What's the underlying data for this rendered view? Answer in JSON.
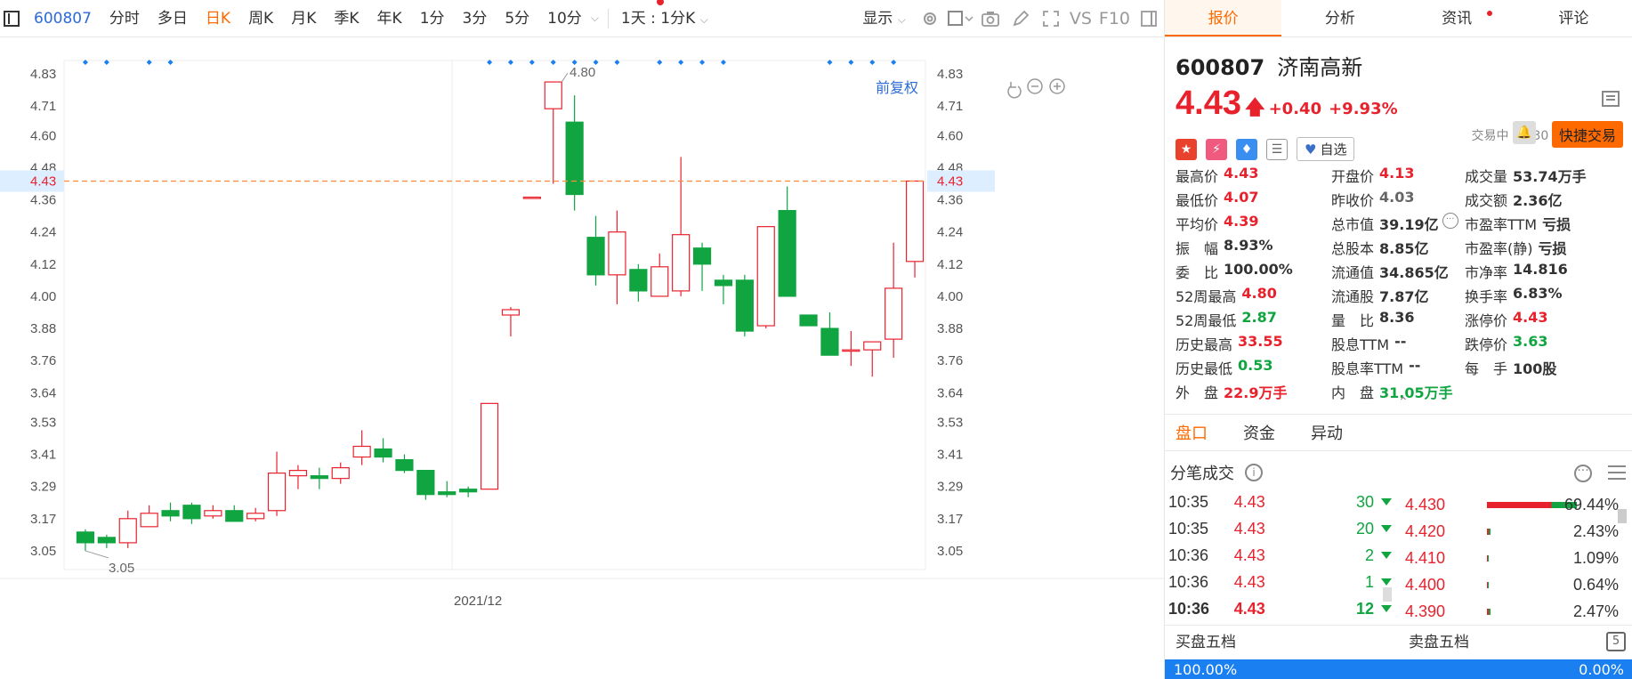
{
  "toolbar": {
    "code": "600807",
    "periods": [
      "分时",
      "多日",
      "日K",
      "周K",
      "月K",
      "季K",
      "年K",
      "1分",
      "3分",
      "5分",
      "10分"
    ],
    "active_period": "日K",
    "interval_select": "1天 : 1分K",
    "display_label": "显示",
    "vs_label": "VS",
    "f10_label": "F10"
  },
  "chart": {
    "adjust_label": "前复权",
    "x_label": "2021/12",
    "current_price_label": "4.43",
    "y_ticks": [
      "4.83",
      "4.71",
      "4.60",
      "4.48",
      "4.36",
      "4.24",
      "4.12",
      "4.00",
      "3.88",
      "3.76",
      "3.64",
      "3.53",
      "3.41",
      "3.29",
      "3.17",
      "3.05"
    ],
    "high_annotation": "4.80",
    "low_annotation": "3.05",
    "colors": {
      "up": "#e8222d",
      "down": "#10a540",
      "current_line": "#ff8a3d",
      "marker": "#1a7ff0"
    }
  },
  "chart_data": {
    "type": "candlestick",
    "ylim": [
      2.98,
      4.88
    ],
    "current_price": 4.43,
    "candles": [
      {
        "o": 3.12,
        "c": 3.08,
        "h": 3.13,
        "l": 3.05
      },
      {
        "o": 3.1,
        "c": 3.08,
        "h": 3.11,
        "l": 3.06
      },
      {
        "o": 3.08,
        "c": 3.17,
        "h": 3.2,
        "l": 3.06
      },
      {
        "o": 3.14,
        "c": 3.19,
        "h": 3.22,
        "l": 3.14
      },
      {
        "o": 3.2,
        "c": 3.18,
        "h": 3.23,
        "l": 3.16
      },
      {
        "o": 3.22,
        "c": 3.17,
        "h": 3.23,
        "l": 3.15
      },
      {
        "o": 3.18,
        "c": 3.2,
        "h": 3.22,
        "l": 3.17
      },
      {
        "o": 3.2,
        "c": 3.16,
        "h": 3.22,
        "l": 3.16
      },
      {
        "o": 3.17,
        "c": 3.19,
        "h": 3.21,
        "l": 3.16
      },
      {
        "o": 3.2,
        "c": 3.34,
        "h": 3.42,
        "l": 3.18
      },
      {
        "o": 3.33,
        "c": 3.35,
        "h": 3.37,
        "l": 3.28
      },
      {
        "o": 3.33,
        "c": 3.32,
        "h": 3.36,
        "l": 3.28
      },
      {
        "o": 3.32,
        "c": 3.36,
        "h": 3.38,
        "l": 3.3
      },
      {
        "o": 3.4,
        "c": 3.44,
        "h": 3.5,
        "l": 3.37
      },
      {
        "o": 3.43,
        "c": 3.4,
        "h": 3.47,
        "l": 3.38
      },
      {
        "o": 3.39,
        "c": 3.35,
        "h": 3.41,
        "l": 3.34
      },
      {
        "o": 3.35,
        "c": 3.26,
        "h": 3.35,
        "l": 3.24
      },
      {
        "o": 3.27,
        "c": 3.26,
        "h": 3.31,
        "l": 3.25
      },
      {
        "o": 3.28,
        "c": 3.27,
        "h": 3.29,
        "l": 3.25
      },
      {
        "o": 3.28,
        "c": 3.6,
        "h": 3.6,
        "l": 3.28
      },
      {
        "o": 3.93,
        "c": 3.95,
        "h": 3.96,
        "l": 3.85
      },
      {
        "o": 4.37,
        "c": 4.37,
        "h": 4.37,
        "l": 4.37
      },
      {
        "o": 4.7,
        "c": 4.8,
        "h": 4.8,
        "l": 4.42
      },
      {
        "o": 4.65,
        "c": 4.38,
        "h": 4.75,
        "l": 4.32
      },
      {
        "o": 4.22,
        "c": 4.08,
        "h": 4.3,
        "l": 4.04
      },
      {
        "o": 4.08,
        "c": 4.24,
        "h": 4.32,
        "l": 3.97
      },
      {
        "o": 4.1,
        "c": 4.02,
        "h": 4.12,
        "l": 3.98
      },
      {
        "o": 4.0,
        "c": 4.11,
        "h": 4.16,
        "l": 4.0
      },
      {
        "o": 4.02,
        "c": 4.23,
        "h": 4.52,
        "l": 4.0
      },
      {
        "o": 4.18,
        "c": 4.12,
        "h": 4.2,
        "l": 4.02
      },
      {
        "o": 4.06,
        "c": 4.04,
        "h": 4.08,
        "l": 3.97
      },
      {
        "o": 4.06,
        "c": 3.87,
        "h": 4.08,
        "l": 3.85
      },
      {
        "o": 3.89,
        "c": 4.26,
        "h": 4.26,
        "l": 3.88
      },
      {
        "o": 4.32,
        "c": 4.0,
        "h": 4.41,
        "l": 4.0
      },
      {
        "o": 3.93,
        "c": 3.89,
        "h": 3.93,
        "l": 3.89
      },
      {
        "o": 3.88,
        "c": 3.78,
        "h": 3.94,
        "l": 3.78
      },
      {
        "o": 3.8,
        "c": 3.8,
        "h": 3.87,
        "l": 3.74
      },
      {
        "o": 3.8,
        "c": 3.83,
        "h": 3.83,
        "l": 3.7
      },
      {
        "o": 3.84,
        "c": 4.03,
        "h": 4.2,
        "l": 3.77
      },
      {
        "o": 4.13,
        "c": 4.43,
        "h": 4.43,
        "l": 4.07
      }
    ]
  },
  "tabs": [
    "报价",
    "分析",
    "资讯",
    "评论"
  ],
  "stock": {
    "code": "600807",
    "name": "济南高新",
    "price": "4.43",
    "change": "+0.40",
    "change_pct": "+9.93%",
    "status": "交易中 12/30 10:36(北京)",
    "watch_label": "自选",
    "quick_trade_label": "快捷交易"
  },
  "quote_rows": [
    [
      {
        "l": "最高价",
        "v": "4.43",
        "c": "red"
      },
      {
        "l": "开盘价",
        "v": "4.13",
        "c": "red"
      },
      {
        "l": "成交量",
        "v": "53.74万手",
        "c": ""
      }
    ],
    [
      {
        "l": "最低价",
        "v": "4.07",
        "c": "red"
      },
      {
        "l": "昨收价",
        "v": "4.03",
        "c": "gray"
      },
      {
        "l": "成交额",
        "v": "2.36亿",
        "c": ""
      }
    ],
    [
      {
        "l": "平均价",
        "v": "4.39",
        "c": "red"
      },
      {
        "l": "总市值",
        "v": "39.19亿",
        "c": ""
      },
      {
        "l": "市盈率TTM",
        "v": "亏损",
        "c": ""
      }
    ],
    [
      {
        "l": "振　幅",
        "v": "8.93%",
        "c": ""
      },
      {
        "l": "总股本",
        "v": "8.85亿",
        "c": ""
      },
      {
        "l": "市盈率(静)",
        "v": "亏损",
        "c": ""
      }
    ],
    [
      {
        "l": "委　比",
        "v": "100.00%",
        "c": ""
      },
      {
        "l": "流通值",
        "v": "34.865亿",
        "c": ""
      },
      {
        "l": "市净率",
        "v": "14.816",
        "c": ""
      }
    ],
    [
      {
        "l": "52周最高",
        "v": "4.80",
        "c": "red"
      },
      {
        "l": "流通股",
        "v": "7.87亿",
        "c": ""
      },
      {
        "l": "换手率",
        "v": "6.83%",
        "c": ""
      }
    ],
    [
      {
        "l": "52周最低",
        "v": "2.87",
        "c": "green"
      },
      {
        "l": "量　比",
        "v": "8.36",
        "c": ""
      },
      {
        "l": "涨停价",
        "v": "4.43",
        "c": "red"
      }
    ],
    [
      {
        "l": "历史最高",
        "v": "33.55",
        "c": "red"
      },
      {
        "l": "股息TTM",
        "v": "--",
        "c": ""
      },
      {
        "l": "跌停价",
        "v": "3.63",
        "c": "green"
      }
    ],
    [
      {
        "l": "历史最低",
        "v": "0.53",
        "c": "green"
      },
      {
        "l": "股息率TTM",
        "v": "--",
        "c": ""
      },
      {
        "l": "每　手",
        "v": "100股",
        "c": ""
      }
    ],
    [
      {
        "l": "外　盘",
        "v": "22.9万手",
        "c": "red"
      },
      {
        "l": "内　盘",
        "v": "31.05万手",
        "c": "green"
      },
      {
        "l": "",
        "v": "",
        "c": ""
      }
    ]
  ],
  "sub_tabs": [
    "盘口",
    "资金",
    "异动"
  ],
  "ticks_title": "分笔成交",
  "ticks": [
    {
      "t": "10:35",
      "p": "4.43",
      "v": "30"
    },
    {
      "t": "10:35",
      "p": "4.43",
      "v": "20"
    },
    {
      "t": "10:36",
      "p": "4.43",
      "v": "2"
    },
    {
      "t": "10:36",
      "p": "4.43",
      "v": "1"
    },
    {
      "t": "10:36",
      "p": "4.43",
      "v": "12"
    }
  ],
  "dist": [
    {
      "p": "4.430",
      "pct": "69.44%",
      "frac": 0.6944
    },
    {
      "p": "4.420",
      "pct": "2.43%",
      "frac": 0.0243
    },
    {
      "p": "4.410",
      "pct": "1.09%",
      "frac": 0.0109
    },
    {
      "p": "4.400",
      "pct": "0.64%",
      "frac": 0.0064
    },
    {
      "p": "4.390",
      "pct": "2.47%",
      "frac": 0.0247
    }
  ],
  "five": {
    "buy_label": "买盘五档",
    "sell_label": "卖盘五档",
    "buy_pct": "100.00%",
    "sell_pct": "0.00%"
  }
}
